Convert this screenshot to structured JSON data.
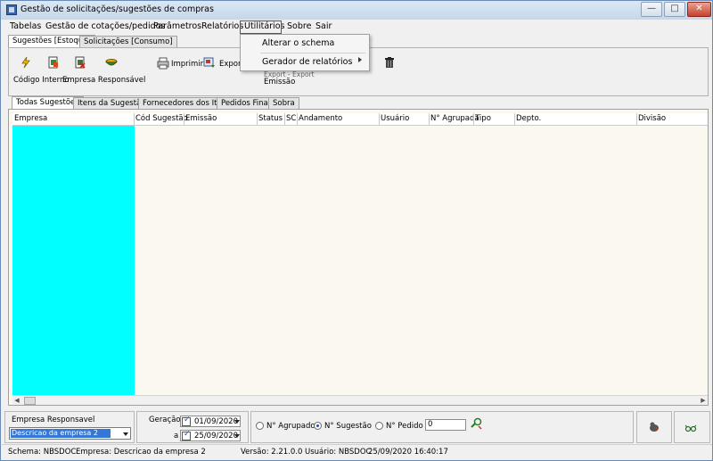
{
  "window": {
    "title": "Gestão de solicitações/sugestões de compras",
    "minimize": "—",
    "maximize": "□",
    "close": "✕"
  },
  "menubar": {
    "items": [
      "Tabelas",
      "Gestão de cotações/pedidos",
      "Parâmetros",
      "Relatórios",
      "Utilitários",
      "Sobre",
      "Sair"
    ]
  },
  "dropdown": {
    "items": [
      "Alterar o schema",
      "Gerador de relatórios"
    ]
  },
  "top_tabs": [
    "Sugestões [Estoque]",
    "Solicitações [Consumo]"
  ],
  "toolbar": {
    "print_label": "Imprimir",
    "export_label": "Exportar",
    "export_hidden_label": "Export - Export",
    "icons": [
      "lightning-icon",
      "page-edit-icon",
      "page-delete-icon",
      "bowl-icon",
      "printer-icon",
      "export-icon",
      "trash-icon"
    ]
  },
  "fields": {
    "codigo_interno": "Código Interno",
    "empresa_responsavel": "Empresa Responsável",
    "emissao": "Emissão"
  },
  "inner_tabs": [
    "Todas Sugestões",
    "Itens da Sugestão",
    "Fornecedores dos Itens",
    "Pedidos Finais",
    "Sobra"
  ],
  "grid": {
    "columns": [
      "Empresa",
      "Cód Sugestão",
      "Emissão",
      "Status",
      "SC",
      "Andamento",
      "Usuário",
      "N° Agrupada",
      "Tipo",
      "Depto.",
      "Divisão"
    ]
  },
  "filters": {
    "empresa_label": "Empresa Responsavel",
    "empresa_value": "Descricao da empresa 2",
    "geracao_label": "Geração",
    "a_label": "a",
    "date_from": "01/09/2020",
    "date_to": "25/09/2020",
    "radio_options": [
      "N° Agrupado",
      "N° Sugestão",
      "N° Pedido"
    ],
    "selected_radio": "N° Sugestão",
    "number_value": "0"
  },
  "statusbar": {
    "schema": "Schema: NBSDOC",
    "empresa": "Empresa: Descricao da empresa 2",
    "versao": "Versão: 2.21.0.0",
    "usuario": "Usuário: NBSDOC",
    "datetime": "25/09/2020 16:40:17"
  },
  "colors": {
    "cyan_column": "#00ffff",
    "grid_background": "#fbf9ef",
    "menu_highlight_border": "#e11c1c",
    "selection_blue": "#3378d6"
  }
}
